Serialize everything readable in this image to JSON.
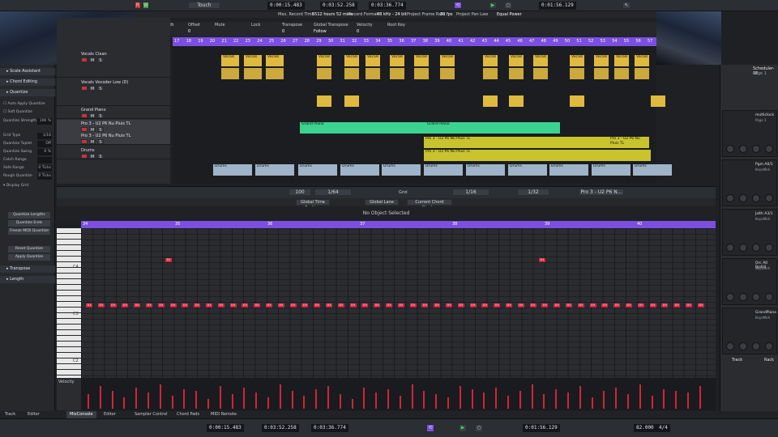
{
  "toolbar": {
    "mode": "Touch",
    "time_left": "0:00:15.483",
    "time_mid": "0:03:52.258",
    "time_right": "0:03:36.774",
    "time_pos": "0:01:56.129",
    "rec_labels": [
      "Max. Record Time",
      "Record Format",
      "Project Frame Rate",
      "Project Pan Law"
    ],
    "rec_values": [
      "5512 hours 52 mins",
      "48 kHz - 24 bit",
      "30 fps",
      "Equal Power"
    ]
  },
  "info_line": {
    "headers": [
      "Length",
      "Offset",
      "Mute",
      "Lock",
      "Transpose",
      "Global Transpose",
      "Velocity",
      "Root Key"
    ],
    "values": [
      "",
      "0",
      "",
      "",
      "0",
      "Follow",
      "0",
      ""
    ]
  },
  "ruler_top": [
    "17",
    "18",
    "19",
    "20",
    "21",
    "22",
    "23",
    "24",
    "25",
    "26",
    "27",
    "28",
    "29",
    "30",
    "31",
    "32",
    "33",
    "34",
    "35",
    "36",
    "37",
    "38",
    "39",
    "40",
    "41",
    "42",
    "43",
    "44",
    "45",
    "46",
    "47",
    "48",
    "49",
    "50",
    "51",
    "52",
    "53",
    "54",
    "55",
    "56",
    "57"
  ],
  "tracks": [
    {
      "name": "Vocals Clean"
    },
    {
      "name": "Vocals Vocoder Low (D)"
    },
    {
      "name": "Grand Piano"
    },
    {
      "name": "Pro 3 - U2 P6 Nu Pluis TL"
    },
    {
      "name": "Pro 3 - U2 P6 Nu Pluis TL"
    },
    {
      "name": "Drums"
    }
  ],
  "parts": {
    "vocal": "Vocals",
    "piano": "Grand Piano",
    "pro3": "Pro 3 - U2 P6 Nu Pluis TL",
    "drums": "Drums"
  },
  "inspector": {
    "sections": [
      "Scale Assistant",
      "Chord Editing",
      "Quantize"
    ],
    "quantize_opts": [
      "Auto Apply Quantize",
      "Soft Quantize"
    ],
    "rows": [
      {
        "label": "Quantize Strength",
        "value": "100 %"
      },
      {
        "label": "Grid Type",
        "value": "1/16"
      },
      {
        "label": "Quantize Tuplet",
        "value": "Off"
      },
      {
        "label": "Quantize Swing",
        "value": "0 %"
      },
      {
        "label": "Catch Range",
        "value": ""
      },
      {
        "label": "Safe Range",
        "value": "0 Ticks"
      },
      {
        "label": "Rough Quantize",
        "value": "0 Ticks"
      }
    ],
    "display_grid": "Display Grid",
    "buttons": [
      "Quantize Lengths",
      "Quantize Ends",
      "Freeze MIDI Quantize",
      "Reset Quantize",
      "Apply Quantize"
    ],
    "bottom_sections": [
      "Transpose",
      "Length"
    ]
  },
  "editor": {
    "zoom": "100",
    "length": "1/64",
    "grid_label": "Grid",
    "grid": "1/16",
    "quant": "1/32",
    "track": "Pro 3 - U2 P6 N...",
    "sub_buttons": [
      "Global Time Position",
      "Global Lane",
      "Current Chord Display"
    ],
    "status": "No Object Selected",
    "ruler": [
      "34",
      "35",
      "36",
      "37",
      "38",
      "39",
      "40"
    ],
    "key_labels": [
      "C4",
      "C3",
      "C2"
    ],
    "note_label": "D3",
    "high_note": "D4",
    "vel_label": "Velocity"
  },
  "right_panel": {
    "slots": [
      {
        "title": "multiclock",
        "sub": "Page 1"
      },
      {
        "title": "Pgm A0/1",
        "sub": "KeyaMidi"
      },
      {
        "title": "Jxlth A3/1",
        "sub": "KeyaMidi"
      },
      {
        "title": "Orc A0 Bp4/4",
        "sub": "KeyaMidi"
      },
      {
        "title": "GrandPiano",
        "sub": "KeyaMidi"
      }
    ],
    "top_title": "Scheduler-SE",
    "top_sub": "Page 1",
    "tabs": [
      "Track",
      "Rack"
    ]
  },
  "bottom_tabs": [
    "Track",
    "Editor",
    "MixConsole",
    "Editor",
    "Sampler Control",
    "Chord Pads",
    "MIDI Remote"
  ],
  "transport": {
    "t1": "0:00:15.483",
    "t2": "0:03:52.258",
    "t3": "0:03:36.774",
    "pos": "0:01:56.129",
    "tempo": "82.000",
    "sig": "4/4"
  },
  "colors": {
    "accent": "#7b4fe0",
    "note": "#d0243c",
    "vocal": "#e0b93f",
    "piano": "#3bd38f",
    "pro3": "#c9c32e"
  }
}
